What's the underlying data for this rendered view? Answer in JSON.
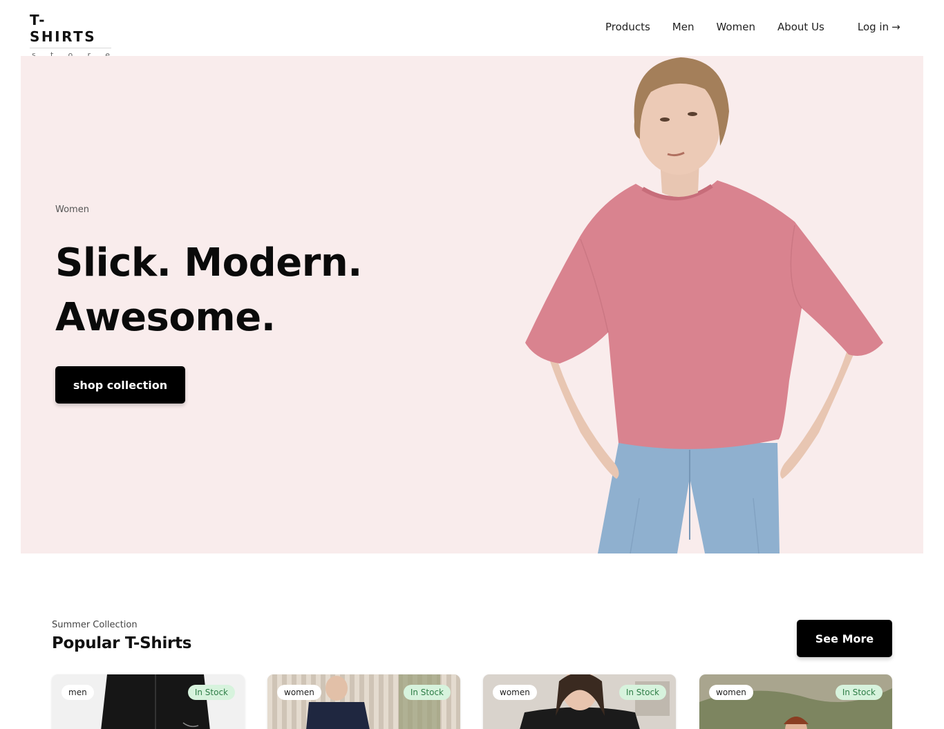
{
  "brand": {
    "title": "T-SHIRTS",
    "subtitle_letters": [
      "s",
      "t",
      "o",
      "r",
      "e"
    ]
  },
  "nav": {
    "products": "Products",
    "men": "Men",
    "women": "Women",
    "about": "About Us",
    "login": "Log in",
    "login_arrow": "→"
  },
  "hero": {
    "eyebrow": "Women",
    "line1": "Slick. Modern.",
    "line2": "Awesome.",
    "cta": "shop collection",
    "background": "#f9ecec"
  },
  "popular": {
    "eyebrow": "Summer Collection",
    "title": "Popular T-Shirts",
    "see_more": "See More",
    "cards": [
      {
        "category": "men",
        "stock": "In Stock"
      },
      {
        "category": "women",
        "stock": "In Stock"
      },
      {
        "category": "women",
        "stock": "In Stock"
      },
      {
        "category": "women",
        "stock": "In Stock"
      }
    ]
  },
  "colors": {
    "accent": "#000000",
    "stock_bg": "#d7f3dd",
    "stock_text": "#2e7d46",
    "shirt": "#d9838f",
    "denim": "#8fb0cf"
  }
}
